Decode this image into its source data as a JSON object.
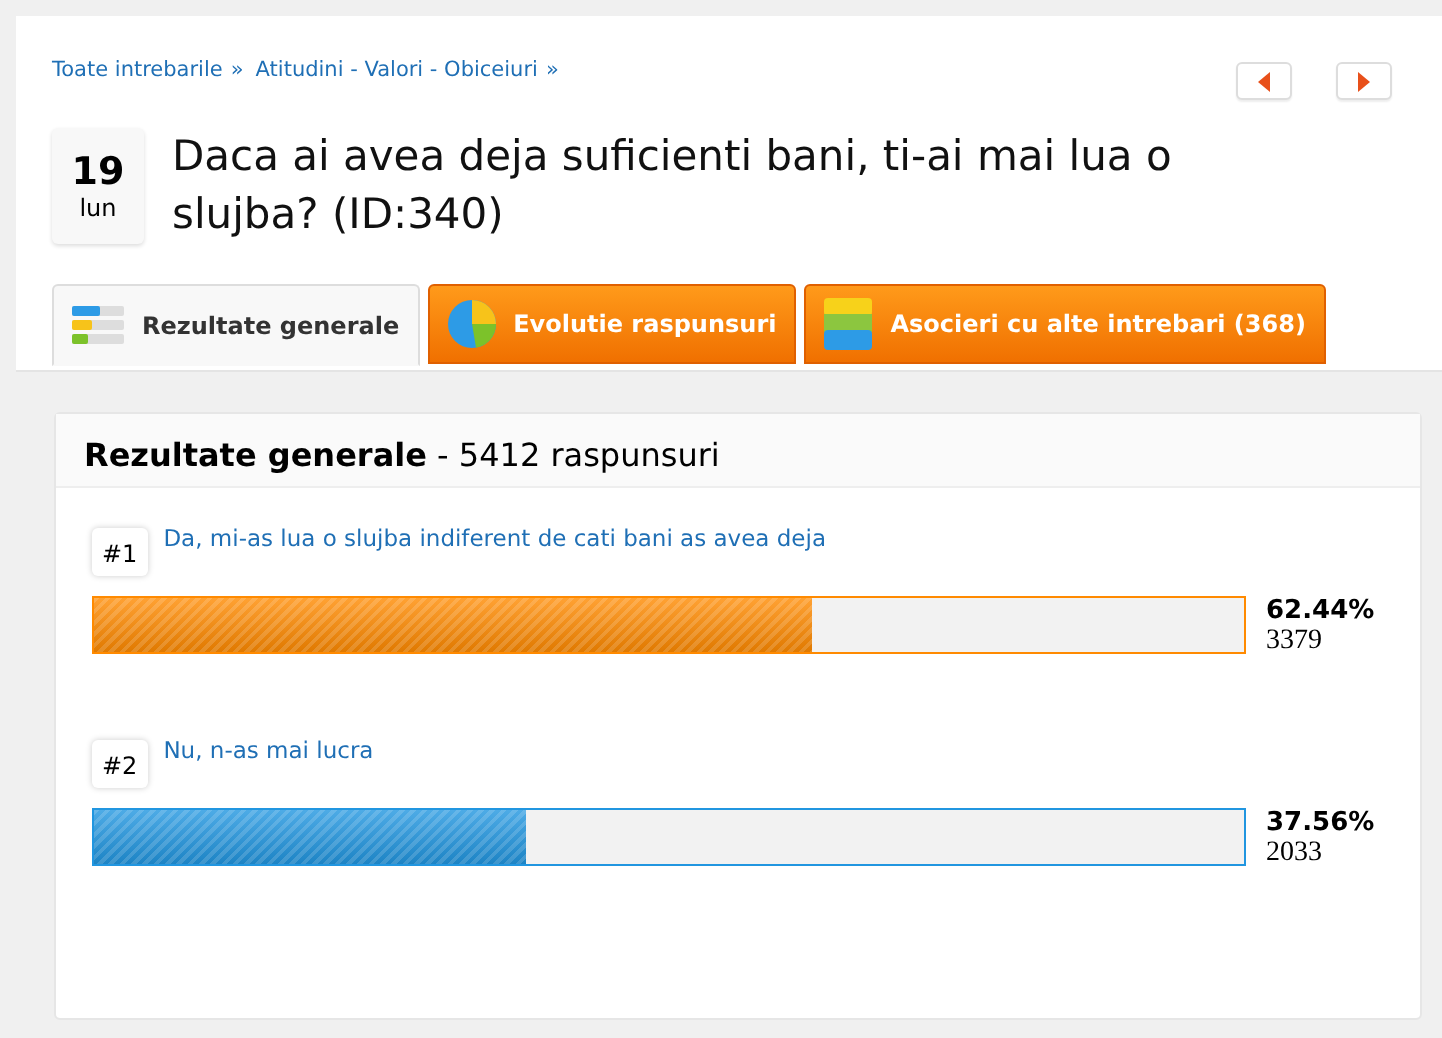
{
  "breadcrumb": [
    {
      "label": "Toate intrebarile",
      "separator": "»"
    },
    {
      "label": "Atitudini - Valori - Obiceiuri",
      "separator": "»"
    }
  ],
  "date": {
    "day": "19",
    "weekday": "lun"
  },
  "question": "Daca ai avea deja suficienti bani, ti-ai mai lua o slujba? (ID:340)",
  "tabs": [
    {
      "label": "Rezultate generale",
      "selected": true,
      "kind": "bars"
    },
    {
      "label": "Evolutie raspunsuri",
      "selected": false,
      "kind": "pie"
    },
    {
      "label": "Asocieri cu alte intrebari (368)",
      "selected": false,
      "kind": "blocks"
    }
  ],
  "results": {
    "title": "Rezultate generale",
    "count": "- 5412 raspunsuri",
    "answers": [
      {
        "rank": "#1",
        "text": "Da, mi-as lua o slujba indiferent de cati bani as avea deja",
        "level": 0.6244,
        "percent": "62.44%",
        "votes": "3379",
        "color": "#ff8a00"
      },
      {
        "rank": "#2",
        "text": "Nu, n-as mai lucra",
        "level": 0.3756,
        "percent": "37.56%",
        "votes": "2033",
        "color": "#2196e0"
      }
    ]
  }
}
